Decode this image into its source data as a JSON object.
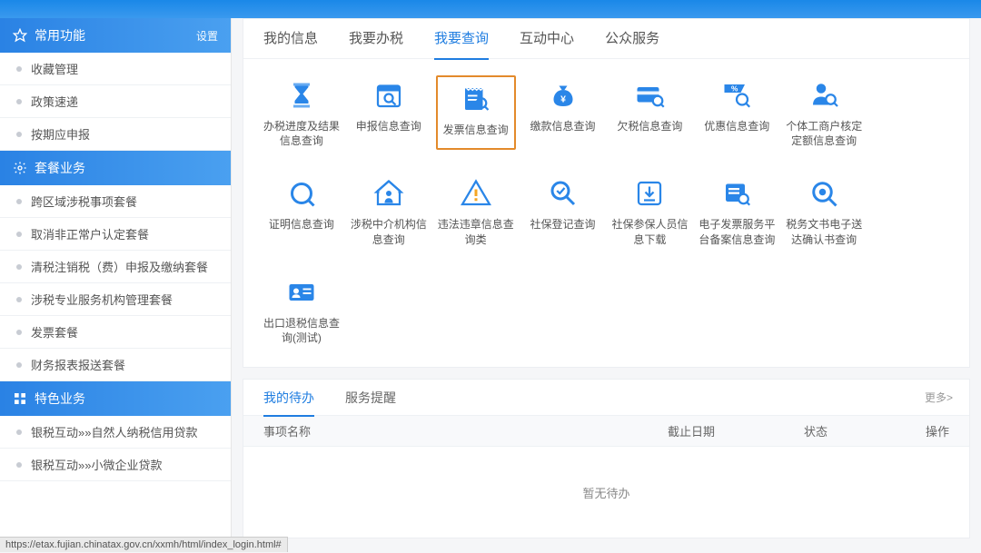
{
  "sidebar": {
    "sections": [
      {
        "title": "常用功能",
        "settings": "设置",
        "icon": "star",
        "items": [
          "收藏管理",
          "政策速递",
          "按期应申报"
        ]
      },
      {
        "title": "套餐业务",
        "icon": "gear",
        "items": [
          "跨区域涉税事项套餐",
          "取消非正常户认定套餐",
          "清税注销税（费）申报及缴纳套餐",
          "涉税专业服务机构管理套餐",
          "发票套餐",
          "财务报表报送套餐"
        ]
      },
      {
        "title": "特色业务",
        "icon": "grid",
        "items": [
          "银税互动»»自然人纳税信用贷款",
          "银税互动»»小微企业贷款"
        ]
      }
    ]
  },
  "mainTabs": [
    {
      "label": "我的信息"
    },
    {
      "label": "我要办税"
    },
    {
      "label": "我要查询",
      "active": true
    },
    {
      "label": "互动中心"
    },
    {
      "label": "公众服务"
    }
  ],
  "tiles": [
    {
      "label": "办税进度及结果信息查询",
      "icon": "hourglass"
    },
    {
      "label": "申报信息查询",
      "icon": "calendar-search"
    },
    {
      "label": "发票信息查询",
      "icon": "invoice-search",
      "highlight": true
    },
    {
      "label": "缴款信息查询",
      "icon": "money-bag"
    },
    {
      "label": "欠税信息查询",
      "icon": "card-search"
    },
    {
      "label": "优惠信息查询",
      "icon": "percent-search"
    },
    {
      "label": "个体工商户核定定额信息查询",
      "icon": "person-search"
    },
    {
      "label": "证明信息查询",
      "icon": "doc-search"
    },
    {
      "label": "涉税中介机构信息查询",
      "icon": "house-person"
    },
    {
      "label": "违法违章信息查询类",
      "icon": "warning"
    },
    {
      "label": "社保登记查询",
      "icon": "magnifier-check"
    },
    {
      "label": "社保参保人员信息下载",
      "icon": "download-box"
    },
    {
      "label": "电子发票服务平台备案信息查询",
      "icon": "ticket-search"
    },
    {
      "label": "税务文书电子送达确认书查询",
      "icon": "file-search"
    },
    {
      "label": "出口退税信息查询(测试)",
      "icon": "id-card"
    }
  ],
  "lowerTabs": [
    {
      "label": "我的待办",
      "active": true
    },
    {
      "label": "服务提醒"
    }
  ],
  "lowerMore": "更多>",
  "tableHeaders": {
    "c1": "事项名称",
    "c2": "截止日期",
    "c3": "状态",
    "c4": "操作"
  },
  "emptyText": "暂无待办",
  "statusUrl": "https://etax.fujian.chinatax.gov.cn/xxmh/html/index_login.html#"
}
